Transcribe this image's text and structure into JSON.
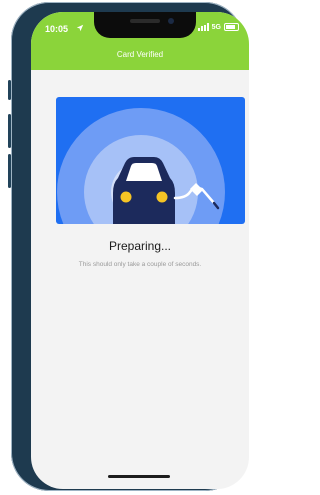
{
  "status_bar": {
    "time": "10:05",
    "network": "5G"
  },
  "header": {
    "title": "Card Verified"
  },
  "main": {
    "heading": "Preparing...",
    "message": "This should only take a couple of seconds."
  },
  "colors": {
    "header": "#8bd43a",
    "illustration_bg": "#1f6ff2",
    "car": "#1c2a5c",
    "headlights": "#f5c425"
  },
  "icons": [
    "location-arrow-icon",
    "signal-icon",
    "battery-icon",
    "car-charging-illustration"
  ]
}
